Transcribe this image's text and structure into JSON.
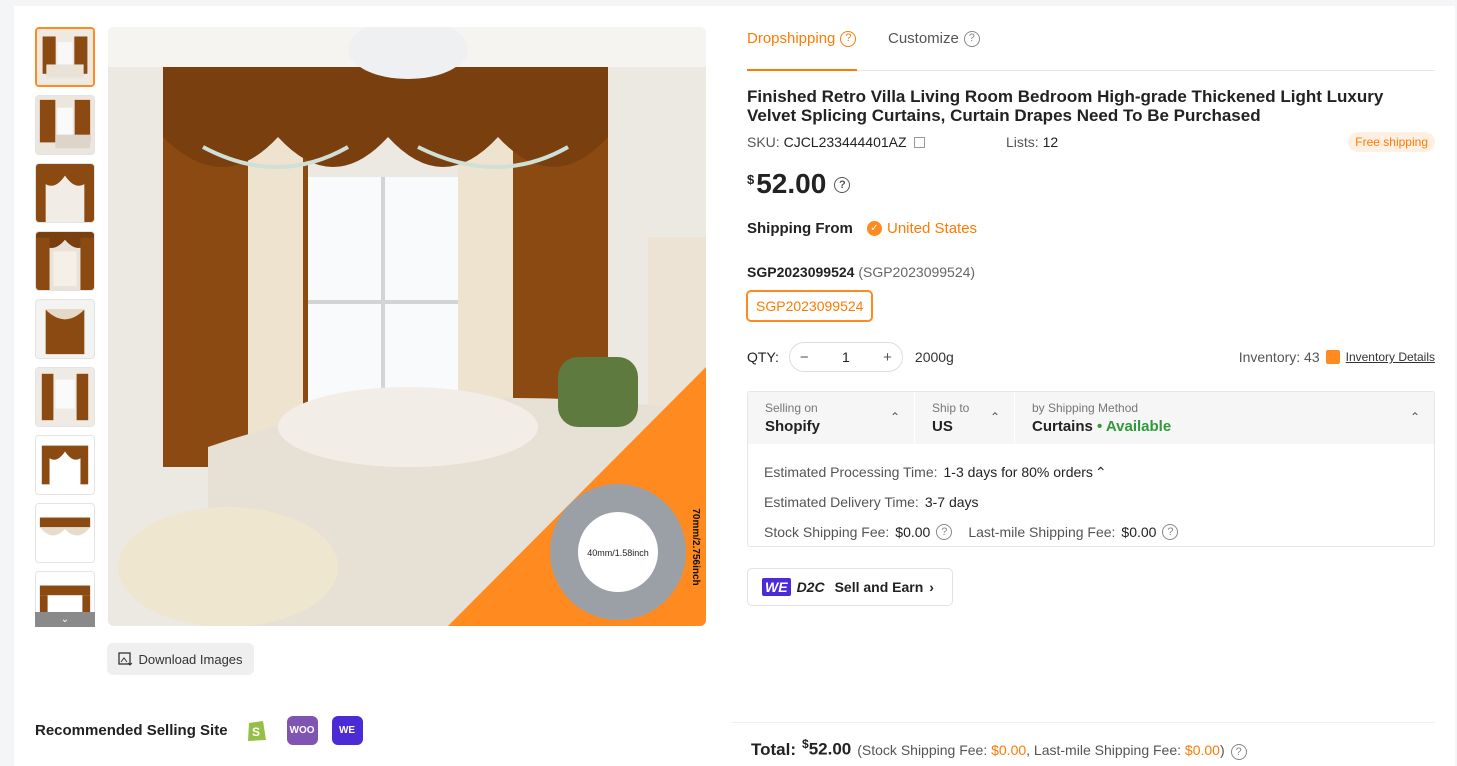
{
  "tabs": [
    {
      "label": "Dropshipping",
      "active": true
    },
    {
      "label": "Customize",
      "active": false
    }
  ],
  "product": {
    "title": "Finished Retro Villa Living Room Bedroom High-grade Thickened Light Luxury Velvet Splicing Curtains, Curtain Drapes Need To Be Purchased",
    "sku_label": "SKU:",
    "sku": "CJCL233444401AZ",
    "lists_label": "Lists:",
    "lists": "12",
    "free_shipping": "Free shipping",
    "price_currency": "$",
    "price": "52.00"
  },
  "shipping_from": {
    "label": "Shipping From",
    "value": "United States"
  },
  "variant": {
    "name": "SGP2023099524",
    "name_paren": "(SGP2023099524)",
    "option": "SGP2023099524"
  },
  "qty": {
    "label": "QTY:",
    "value": "1",
    "weight": "2000g",
    "minus": "−",
    "plus": "+"
  },
  "inventory": {
    "label": "Inventory: 43",
    "link": "Inventory Details"
  },
  "shipping": {
    "selling_on_label": "Selling on",
    "selling_on": "Shopify",
    "ship_to_label": "Ship to",
    "ship_to": "US",
    "method_label": "by Shipping Method",
    "method": "Curtains",
    "availability": "• Available",
    "processing_label": "Estimated Processing Time:",
    "processing": "1-3 days for 80% orders",
    "delivery_label": "Estimated Delivery Time:",
    "delivery": "3-7 days",
    "stock_fee_label": "Stock Shipping Fee:",
    "stock_fee": "$0.00",
    "last_mile_label": "Last-mile Shipping Fee:",
    "last_mile": "$0.00"
  },
  "sell_earn": {
    "badge": "WE",
    "d2c": "D2C",
    "label": "Sell and Earn"
  },
  "download": {
    "label": "Download Images"
  },
  "recommended": {
    "title": "Recommended Selling Site",
    "sites": [
      "shopify",
      "woo",
      "we-d2c"
    ],
    "woo_text": "WOO",
    "we_text": "WE"
  },
  "total": {
    "label": "Total:",
    "currency": "$",
    "amount": "52.00",
    "pre": "(Stock Shipping Fee:",
    "stock": "$0.00",
    "mid": ", Last-mile Shipping Fee:",
    "last": "$0.00",
    "post": ")"
  },
  "product_image": {
    "ring_inner": "40mm/1.58inch",
    "ring_outer": "70mm/2.756inch"
  },
  "colors": {
    "accent": "#ff7a00",
    "available": "#2e9a3a",
    "curtain": "#8b4a12",
    "we": "#4a2bd6"
  }
}
